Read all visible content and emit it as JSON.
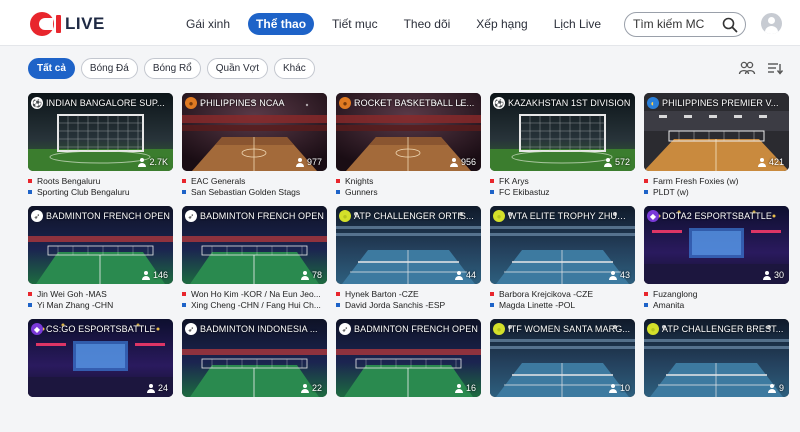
{
  "logo": {
    "text": "LIVE"
  },
  "nav": [
    {
      "label": "Gái xinh"
    },
    {
      "label": "Thể thao",
      "active": true
    },
    {
      "label": "Tiết mục"
    },
    {
      "label": "Theo dõi"
    },
    {
      "label": "Xếp hạng"
    },
    {
      "label": "Lịch Live"
    }
  ],
  "search": {
    "placeholder": "Tìm kiếm MC"
  },
  "filters": [
    {
      "label": "Tất cả",
      "active": true
    },
    {
      "label": "Bóng Đá"
    },
    {
      "label": "Bóng Rổ"
    },
    {
      "label": "Quần Vợt"
    },
    {
      "label": "Khác"
    }
  ],
  "cards": [
    {
      "title": "INDIAN BANGALORE SUP...",
      "sport": "football",
      "scene": "goal",
      "viewers": "2.7K",
      "home": "Roots Bengaluru",
      "away": "Sporting Club Bengaluru"
    },
    {
      "title": "PHILIPPINES NCAA",
      "sport": "basketball",
      "scene": "arena",
      "viewers": "977",
      "home": "EAC Generals",
      "away": "San Sebastian Golden Stags"
    },
    {
      "title": "ROCKET BASKETBALL LE...",
      "sport": "basketball",
      "scene": "arena",
      "viewers": "956",
      "home": "Knights",
      "away": "Gunners"
    },
    {
      "title": "KAZAKHSTAN 1ST DIVISION",
      "sport": "football",
      "scene": "goal",
      "viewers": "572",
      "home": "FK Arys",
      "away": "FC Ekibastuz"
    },
    {
      "title": "PHILIPPINES PREMIER V...",
      "sport": "volleyball",
      "scene": "volley",
      "viewers": "421",
      "home": "Farm Fresh Foxies (w)",
      "away": "PLDT (w)"
    },
    {
      "title": "BADMINTON FRENCH OPEN",
      "sport": "badminton",
      "scene": "badminton",
      "viewers": "146",
      "home": "Jin Wei Goh -MAS",
      "away": "Yi Man Zhang -CHN"
    },
    {
      "title": "BADMINTON FRENCH OPEN",
      "sport": "badminton",
      "scene": "badminton",
      "viewers": "78",
      "home": "Won Ho Kim -KOR / Na Eun Jeo...",
      "away": "Xing Cheng -CHN / Fang Hui Ch..."
    },
    {
      "title": "ATP CHALLENGER ORTIS...",
      "sport": "tennis",
      "scene": "tennis",
      "viewers": "44",
      "home": "Hynek Barton -CZE",
      "away": "David Jorda Sanchis -ESP"
    },
    {
      "title": "WTA ELITE TROPHY ZHUHAI",
      "sport": "tennis",
      "scene": "tennis",
      "viewers": "43",
      "home": "Barbora Krejcikova -CZE",
      "away": "Magda Linette -POL"
    },
    {
      "title": "DOTA2 ESPORTSBATTLE",
      "sport": "esports",
      "scene": "esports",
      "viewers": "30",
      "home": "Fuzanglong",
      "away": "Amanita"
    },
    {
      "title": "CS:GO ESPORTSBATTLE",
      "sport": "esports",
      "scene": "esports",
      "viewers": "24",
      "home": "",
      "away": ""
    },
    {
      "title": "BADMINTON INDONESIA ...",
      "sport": "badminton",
      "scene": "badminton",
      "viewers": "22",
      "home": "",
      "away": ""
    },
    {
      "title": "BADMINTON FRENCH OPEN",
      "sport": "badminton",
      "scene": "badminton",
      "viewers": "16",
      "home": "",
      "away": ""
    },
    {
      "title": "ITF WOMEN SANTA MARG...",
      "sport": "tennis",
      "scene": "tennis",
      "viewers": "10",
      "home": "",
      "away": ""
    },
    {
      "title": "ATP CHALLENGER BREST...",
      "sport": "tennis",
      "scene": "tennis",
      "viewers": "9",
      "home": "",
      "away": ""
    }
  ],
  "colors": {
    "accent": "#1e63c8",
    "brand": "#e8262d",
    "home_marker": "#e8262d",
    "away_marker": "#1e63c8"
  },
  "icons": {
    "search": "search-icon",
    "avatar": "user-avatar-icon",
    "group": "group-icon",
    "sort": "sort-icon",
    "viewer": "person-icon"
  }
}
